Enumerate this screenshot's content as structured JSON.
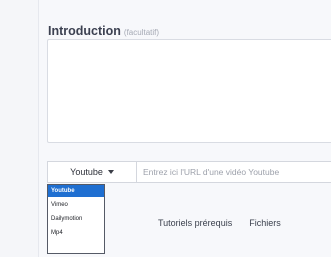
{
  "introduction": {
    "title": "Introduction",
    "optional_label": "(facultatif)",
    "value": ""
  },
  "video": {
    "selected_provider": "Youtube",
    "url_placeholder": "Entrez ici l'URL d'une vidéo Youtube",
    "url_value": "",
    "provider_options": [
      "Youtube",
      "Vimeo",
      "Dailymotion",
      "Mp4"
    ]
  },
  "tabs": [
    {
      "label": "Tutoriels prérequis"
    },
    {
      "label": "Fichiers"
    }
  ],
  "colors": {
    "selected_option": "#1f6fd1"
  }
}
